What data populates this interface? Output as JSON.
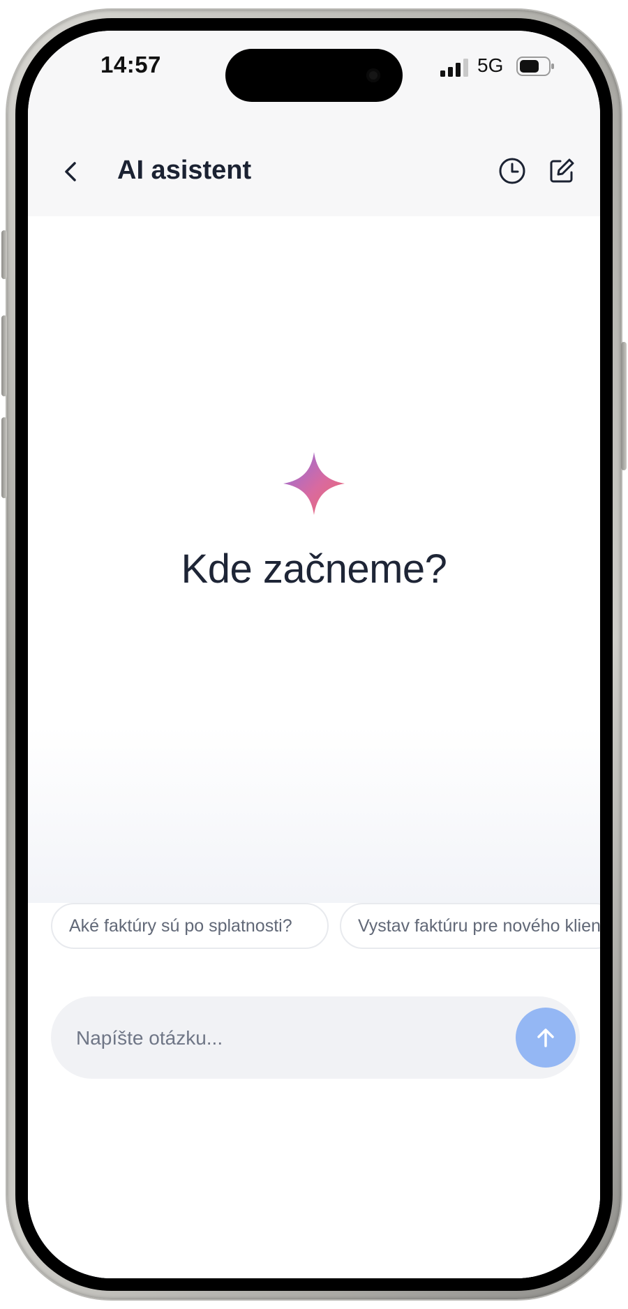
{
  "status_bar": {
    "time": "14:57",
    "network": "5G",
    "icons": [
      "signal-bars-icon",
      "battery-icon"
    ]
  },
  "header": {
    "back_icon": "chevron-left-icon",
    "title": "AI asistent",
    "history_icon": "clock-icon",
    "compose_icon": "new-chat-icon"
  },
  "hero": {
    "icon": "sparkle-star-icon",
    "title": "Kde začneme?"
  },
  "suggestions": [
    {
      "label": "Aké faktúry sú po splatnosti?"
    },
    {
      "label": "Vystav faktúru pre nového klienta"
    }
  ],
  "composer": {
    "placeholder": "Napíšte otázku...",
    "value": "",
    "send_icon": "arrow-up-icon"
  },
  "colors": {
    "accent": "#94b7f4",
    "title_text": "#1b2232",
    "star_gradient": [
      "#8a6ee0",
      "#f06a6a"
    ]
  }
}
